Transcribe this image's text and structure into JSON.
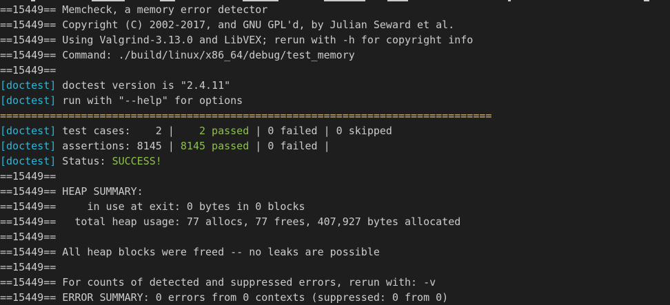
{
  "colors": {
    "background": "#1e1e1e",
    "foreground": "#cccccc",
    "tag": "#29b8db",
    "success": "#8dc149",
    "separator": "#e5c07b"
  },
  "lines": [
    {
      "type": "text",
      "text": "==15449== Memcheck, a memory error detector"
    },
    {
      "type": "text",
      "text": "==15449== Copyright (C) 2002-2017, and GNU GPL'd, by Julian Seward et al."
    },
    {
      "type": "text",
      "text": "==15449== Using Valgrind-3.13.0 and LibVEX; rerun with -h for copyright info"
    },
    {
      "type": "text",
      "text": "==15449== Command: ./build/linux/x86_64/debug/test_memory"
    },
    {
      "type": "text",
      "text": "==15449=="
    },
    {
      "type": "tagged",
      "tag": "[doctest]",
      "text": " doctest version is \"2.4.11\""
    },
    {
      "type": "tagged",
      "tag": "[doctest]",
      "text": " run with \"--help\" for options"
    },
    {
      "type": "sep",
      "text": "==============================================================================="
    },
    {
      "type": "tagged",
      "tag": "[doctest]",
      "segments": [
        {
          "text": " test cases:    2 |    ",
          "cls": ""
        },
        {
          "text": "2 passed",
          "cls": "ok"
        },
        {
          "text": " | 0 failed | 0 skipped",
          "cls": ""
        }
      ]
    },
    {
      "type": "tagged",
      "tag": "[doctest]",
      "segments": [
        {
          "text": " assertions: 8145 | ",
          "cls": ""
        },
        {
          "text": "8145 passed",
          "cls": "ok"
        },
        {
          "text": " | 0 failed |",
          "cls": ""
        }
      ]
    },
    {
      "type": "tagged",
      "tag": "[doctest]",
      "segments": [
        {
          "text": " Status: ",
          "cls": ""
        },
        {
          "text": "SUCCESS!",
          "cls": "ok"
        }
      ]
    },
    {
      "type": "text",
      "text": "==15449=="
    },
    {
      "type": "text",
      "text": "==15449== HEAP SUMMARY:"
    },
    {
      "type": "text",
      "text": "==15449==     in use at exit: 0 bytes in 0 blocks"
    },
    {
      "type": "text",
      "text": "==15449==   total heap usage: 77 allocs, 77 frees, 407,927 bytes allocated"
    },
    {
      "type": "text",
      "text": "==15449=="
    },
    {
      "type": "text",
      "text": "==15449== All heap blocks were freed -- no leaks are possible"
    },
    {
      "type": "text",
      "text": "==15449=="
    },
    {
      "type": "text",
      "text": "==15449== For counts of detected and suppressed errors, rerun with: -v"
    },
    {
      "type": "text",
      "text": "==15449== ERROR SUMMARY: 0 errors from 0 contexts (suppressed: 0 from 0)"
    }
  ]
}
